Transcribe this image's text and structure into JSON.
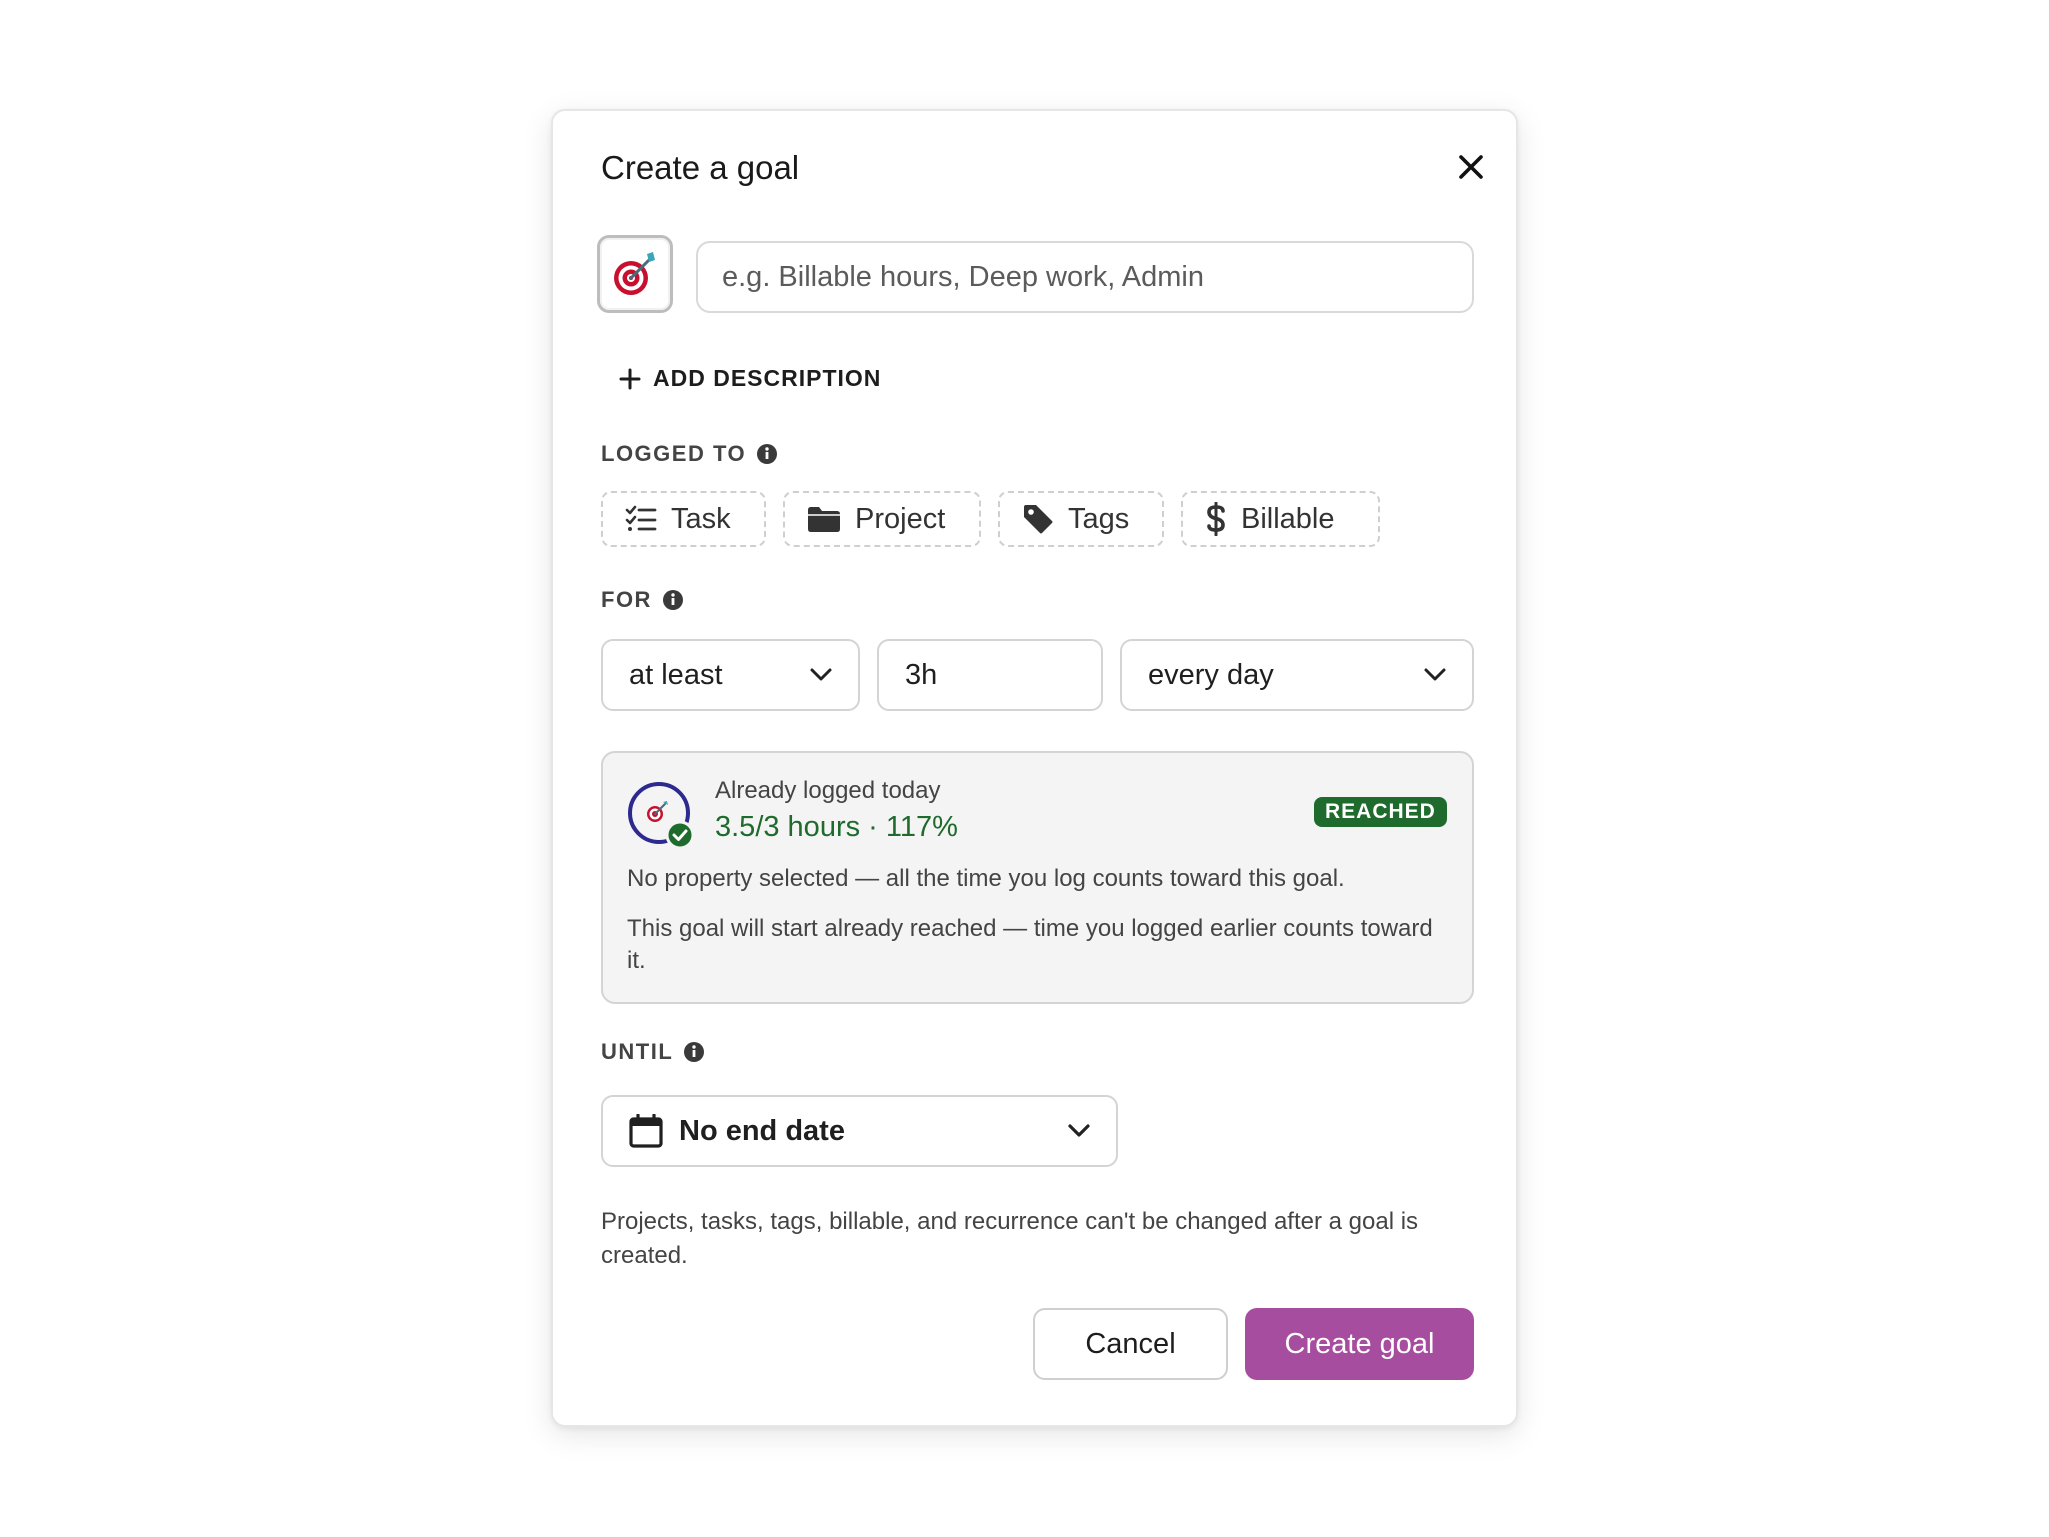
{
  "modal": {
    "title": "Create a goal",
    "close_icon": "close-icon",
    "emoji_icon": "direct-hit-target-icon",
    "name_placeholder": "e.g. Billable hours, Deep work, Admin",
    "name_value": "",
    "add_description": "ADD DESCRIPTION",
    "logged_to": {
      "label": "LOGGED TO",
      "chips": [
        {
          "label": "Task",
          "icon": "task-list-icon"
        },
        {
          "label": "Project",
          "icon": "folder-icon"
        },
        {
          "label": "Tags",
          "icon": "tag-icon"
        },
        {
          "label": "Billable",
          "icon": "dollar-icon"
        }
      ]
    },
    "for": {
      "label": "FOR",
      "operator": "at least",
      "amount": "3h",
      "recurrence": "every day"
    },
    "progress": {
      "heading": "Already logged today",
      "value": "3.5/3 hours · 117%",
      "percent": 117,
      "badge": "REACHED",
      "note1": "No property selected — all the time you log counts toward this goal.",
      "note2": "This goal will start already reached — time you logged earlier counts toward it."
    },
    "until": {
      "label": "UNTIL",
      "value": "No end date"
    },
    "footer_note": "Projects, tasks, tags, billable, and recurrence can't be changed after a goal is created.",
    "cancel_label": "Cancel",
    "create_label": "Create goal"
  },
  "colors": {
    "accent": "#a64d9f",
    "success": "#1e6b2d",
    "ring": "#2d2a8f"
  }
}
